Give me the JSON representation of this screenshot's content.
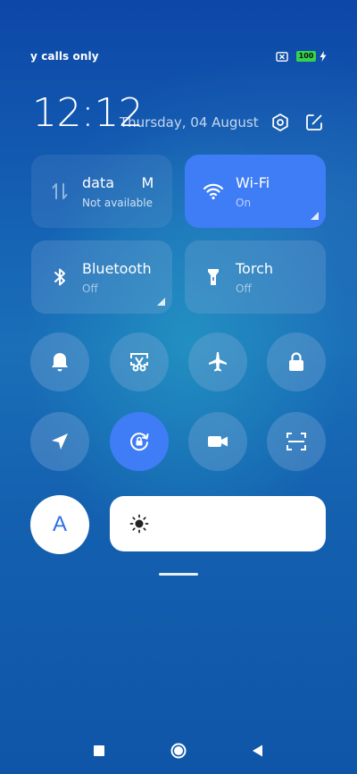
{
  "status_bar": {
    "carrier_text": "y calls only",
    "battery_level": "100",
    "battery_color": "#34d34d",
    "icons": [
      "no-sim-icon",
      "battery-icon",
      "charging-icon"
    ]
  },
  "header": {
    "time": "12:12",
    "date": "Thursday, 04 August",
    "icons": [
      "settings-icon",
      "edit-icon"
    ]
  },
  "tiles": [
    {
      "title": "data      M",
      "subtitle": "Not available",
      "icon": "mobile-data-icon",
      "state": "unavailable"
    },
    {
      "title": "Wi-Fi",
      "subtitle": "On",
      "icon": "wifi-icon",
      "state": "on"
    },
    {
      "title": "Bluetooth",
      "subtitle": "Off",
      "icon": "bluetooth-icon",
      "state": "off"
    },
    {
      "title": "Torch",
      "subtitle": "Off",
      "icon": "torch-icon",
      "state": "off"
    }
  ],
  "toggles_row1": [
    "bell-icon",
    "screenshot-icon",
    "airplane-icon",
    "lock-icon"
  ],
  "toggles_row2": [
    "location-icon",
    "rotation-lock-icon",
    "video-icon",
    "scan-icon"
  ],
  "auto_brightness": {
    "label": "A"
  },
  "accent_color": "#3f7df6",
  "nav": [
    "recents-square-icon",
    "home-circle-icon",
    "back-triangle-icon"
  ]
}
